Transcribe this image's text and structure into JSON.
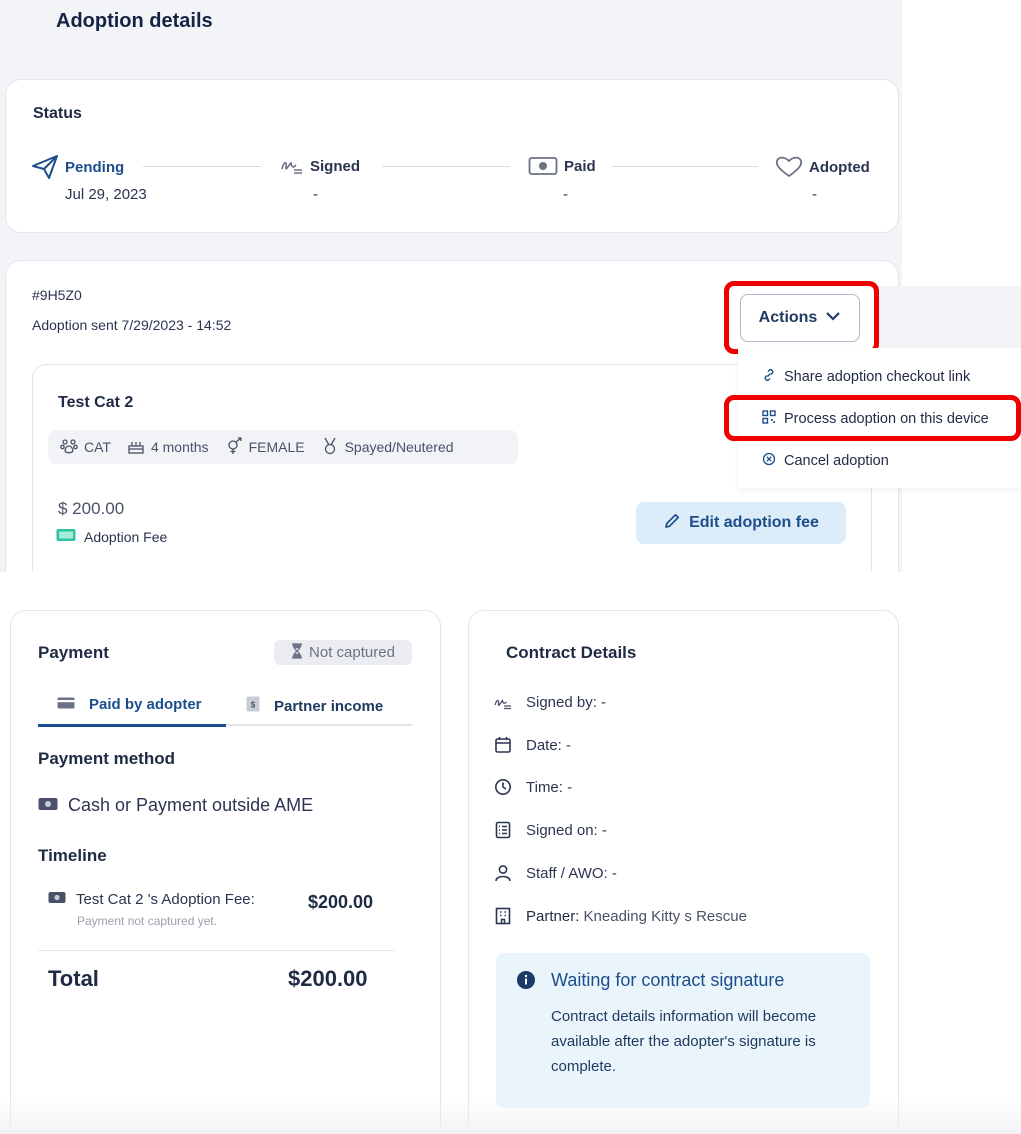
{
  "page": {
    "title": "Adoption details"
  },
  "status": {
    "label": "Status",
    "steps": [
      {
        "label": "Pending",
        "date": "Jul 29, 2023",
        "icon": "paper-plane-icon"
      },
      {
        "label": "Signed",
        "date": "-",
        "icon": "signature-icon"
      },
      {
        "label": "Paid",
        "date": "-",
        "icon": "cash-icon"
      },
      {
        "label": "Adopted",
        "date": "-",
        "icon": "heart-icon"
      }
    ]
  },
  "order": {
    "id": "#9H5Z0",
    "sent": "Adoption sent 7/29/2023 - 14:52",
    "actions_label": "Actions"
  },
  "actions_menu": {
    "items": [
      {
        "label": "Share adoption checkout link",
        "icon": "link-icon"
      },
      {
        "label": "Process adoption on this device",
        "icon": "qr-code-icon"
      },
      {
        "label": "Cancel adoption",
        "icon": "cancel-circle-icon"
      }
    ]
  },
  "pet": {
    "name": "Test Cat 2",
    "species": "CAT",
    "age": "4 months",
    "sex": "FEMALE",
    "fixed": "Spayed/Neutered",
    "fee": "$ 200.00",
    "fee_label": "Adoption Fee",
    "edit_fee_label": "Edit adoption fee"
  },
  "payment": {
    "title": "Payment",
    "badge": "Not captured",
    "tabs": [
      {
        "label": "Paid by adopter",
        "active": true
      },
      {
        "label": "Partner income",
        "active": false
      }
    ],
    "method_title": "Payment method",
    "method": "Cash or Payment outside AME",
    "timeline_title": "Timeline",
    "timeline": [
      {
        "label": "Test Cat 2 's Adoption Fee:",
        "sub": "Payment not captured yet.",
        "amount": "$200.00"
      }
    ],
    "total_label": "Total",
    "total_value": "$200.00"
  },
  "contract": {
    "title": "Contract Details",
    "signed_by": "Signed by: -",
    "date": "Date: -",
    "time": "Time: -",
    "signed_on": "Signed on: -",
    "staff": "Staff / AWO: -",
    "partner_label": "Partner:",
    "partner_value": "Kneading Kitty s Rescue",
    "info_title": "Waiting for contract signature",
    "info_text": "Contract details information will become available after the adopter's signature is complete."
  },
  "colors": {
    "accent": "#1c4e8c",
    "highlight": "#ee0000",
    "info_bg": "#eaf4fb"
  }
}
